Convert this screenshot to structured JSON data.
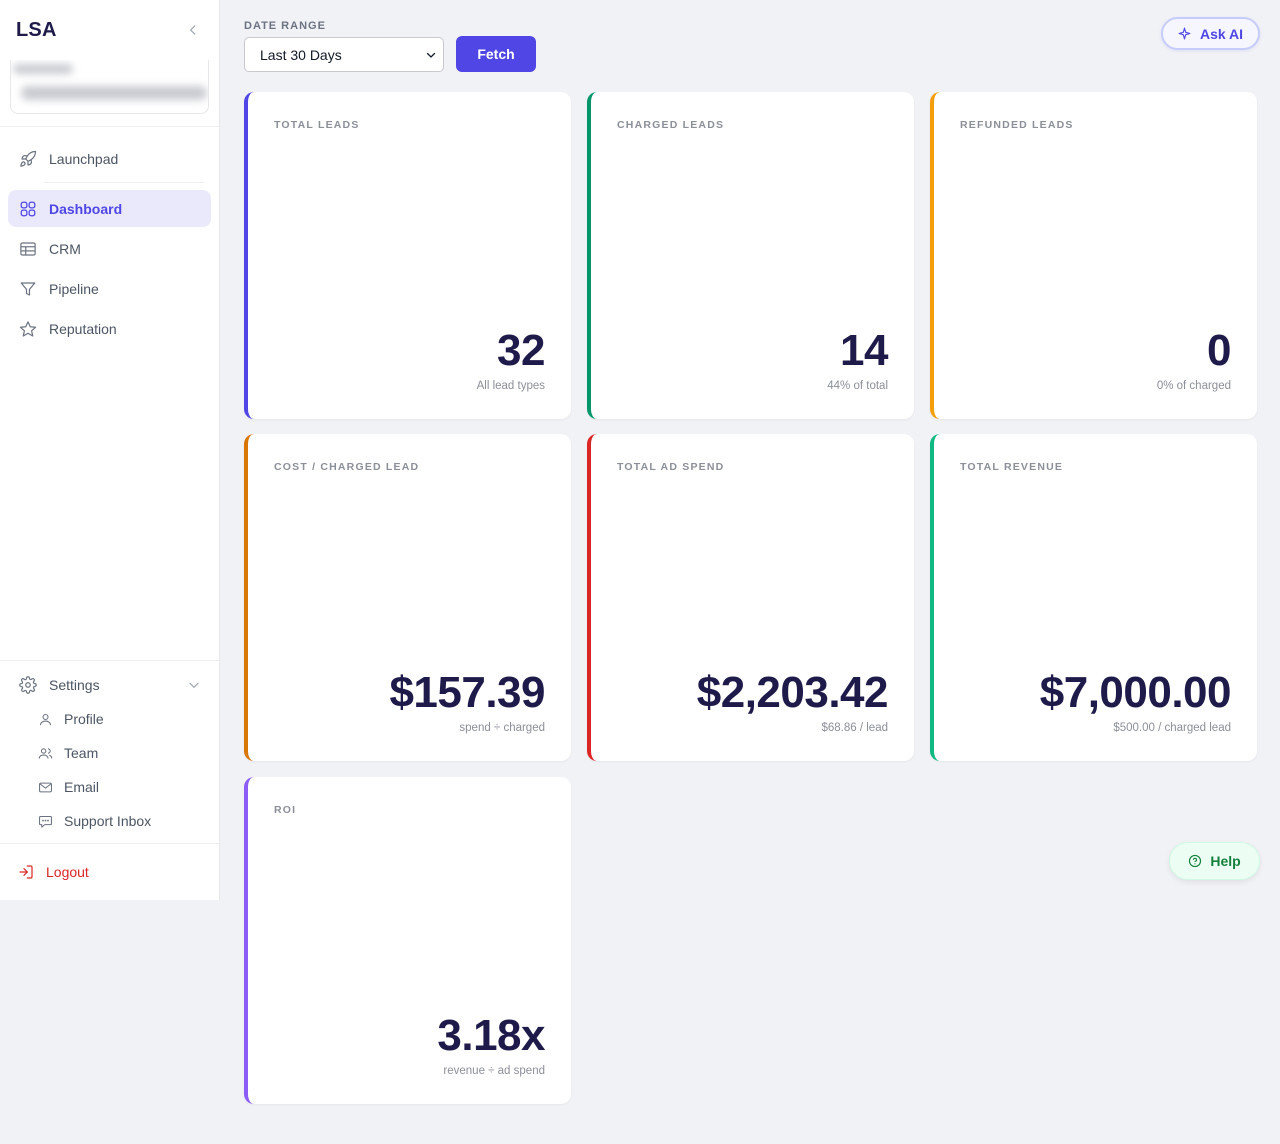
{
  "brand": "LSA",
  "nav": {
    "items": [
      {
        "label": "Launchpad",
        "icon": "rocket-icon"
      },
      {
        "label": "Dashboard",
        "icon": "grid-icon",
        "active": true
      },
      {
        "label": "CRM",
        "icon": "table-icon"
      },
      {
        "label": "Pipeline",
        "icon": "funnel-icon"
      },
      {
        "label": "Reputation",
        "icon": "star-icon"
      }
    ]
  },
  "settings": {
    "label": "Settings",
    "sub_items": [
      {
        "label": "Profile",
        "icon": "user-icon"
      },
      {
        "label": "Team",
        "icon": "users-icon"
      },
      {
        "label": "Email",
        "icon": "mail-icon"
      },
      {
        "label": "Support Inbox",
        "icon": "chat-icon"
      }
    ]
  },
  "logout_label": "Logout",
  "toolbar": {
    "date_range_label": "DATE RANGE",
    "date_range_value": "Last 30 Days",
    "fetch_label": "Fetch",
    "ask_ai_label": "Ask AI"
  },
  "help_label": "Help",
  "colors": {
    "accent": "#4f46e5",
    "total_leads": "#4f46e5",
    "charged_leads": "#059669",
    "refunded_leads": "#f59e0b",
    "cost_charged": "#d97706",
    "ad_spend": "#dc2626",
    "revenue": "#10b981",
    "roi": "#8b5cf6"
  },
  "cards": [
    {
      "label": "TOTAL LEADS",
      "value": "32",
      "sub": "All lead types"
    },
    {
      "label": "CHARGED LEADS",
      "value": "14",
      "sub": "44% of total"
    },
    {
      "label": "REFUNDED LEADS",
      "value": "0",
      "sub": "0% of charged"
    },
    {
      "label": "COST / CHARGED LEAD",
      "value": "$157.39",
      "sub": "spend ÷ charged"
    },
    {
      "label": "TOTAL AD SPEND",
      "value": "$2,203.42",
      "sub": "$68.86 / lead"
    },
    {
      "label": "TOTAL REVENUE",
      "value": "$7,000.00",
      "sub": "$500.00 / charged lead"
    },
    {
      "label": "ROI",
      "value": "3.18x",
      "sub": "revenue ÷ ad spend"
    }
  ]
}
